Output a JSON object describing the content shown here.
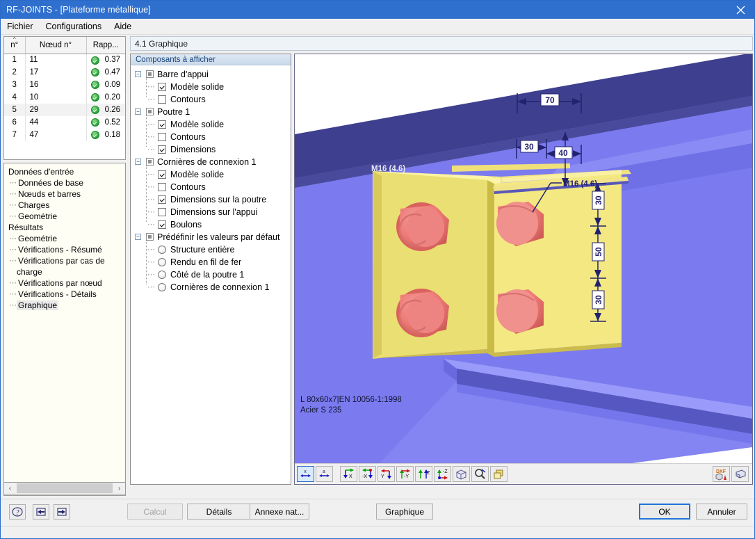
{
  "window": {
    "title": "RF-JOINTS - [Plateforme métallique]",
    "close_icon": "close-icon"
  },
  "menu": {
    "items": [
      {
        "label": "Fichier"
      },
      {
        "label": "Configurations"
      },
      {
        "label": "Aide"
      }
    ]
  },
  "node_grid": {
    "columns": [
      {
        "label": "n°",
        "sort": "^"
      },
      {
        "label": "Nœud n°"
      },
      {
        "label": "Rapp..."
      }
    ],
    "rows": [
      {
        "n": "1",
        "node": "11",
        "ratio": "0.37",
        "status": "ok",
        "selected": false
      },
      {
        "n": "2",
        "node": "17",
        "ratio": "0.47",
        "status": "ok",
        "selected": false
      },
      {
        "n": "3",
        "node": "16",
        "ratio": "0.09",
        "status": "ok",
        "selected": false
      },
      {
        "n": "4",
        "node": "10",
        "ratio": "0.20",
        "status": "ok",
        "selected": false
      },
      {
        "n": "5",
        "node": "29",
        "ratio": "0.26",
        "status": "ok",
        "selected": true
      },
      {
        "n": "6",
        "node": "44",
        "ratio": "0.52",
        "status": "ok",
        "selected": false
      },
      {
        "n": "7",
        "node": "47",
        "ratio": "0.18",
        "status": "ok",
        "selected": false
      }
    ]
  },
  "nav_tree": {
    "groups": [
      {
        "label": "Données d'entrée",
        "children": [
          {
            "label": "Données de base",
            "selected": false
          },
          {
            "label": "Nœuds et barres",
            "selected": false
          },
          {
            "label": "Charges",
            "selected": false
          },
          {
            "label": "Geométrie",
            "selected": false
          }
        ]
      },
      {
        "label": "Résultats",
        "children": [
          {
            "label": "Geométrie",
            "selected": false
          },
          {
            "label": "Vérifications - Résumé",
            "selected": false
          },
          {
            "label": "Vérifications par cas de charge",
            "selected": false
          },
          {
            "label": "Vérifications par nœud",
            "selected": false
          },
          {
            "label": "Vérifications - Détails",
            "selected": false
          },
          {
            "label": "Graphique",
            "selected": true
          }
        ]
      }
    ]
  },
  "left_scroll": {
    "left_arrow": "‹",
    "right_arrow": "›"
  },
  "center": {
    "header_title": "4.1 Graphique",
    "tree_caption": "Composants à afficher",
    "tree": [
      {
        "type": "group",
        "label": "Barre d'appui",
        "expander": "−",
        "children": [
          {
            "type": "check",
            "label": "Modèle solide",
            "checked": true
          },
          {
            "type": "check",
            "label": "Contours",
            "checked": false
          }
        ]
      },
      {
        "type": "group",
        "label": "Poutre 1",
        "expander": "−",
        "children": [
          {
            "type": "check",
            "label": "Modèle solide",
            "checked": true
          },
          {
            "type": "check",
            "label": "Contours",
            "checked": false
          },
          {
            "type": "check",
            "label": "Dimensions",
            "checked": true
          }
        ]
      },
      {
        "type": "group",
        "label": "Cornières de connexion  1",
        "expander": "−",
        "children": [
          {
            "type": "check",
            "label": "Modèle solide",
            "checked": true
          },
          {
            "type": "check",
            "label": "Contours",
            "checked": false
          },
          {
            "type": "check",
            "label": "Dimensions sur la poutre",
            "checked": true
          },
          {
            "type": "check",
            "label": "Dimensions sur l'appui",
            "checked": false
          },
          {
            "type": "check",
            "label": "Boulons",
            "checked": true
          }
        ]
      },
      {
        "type": "group",
        "label": "Prédéfinir les valeurs par défaut",
        "expander": "−",
        "children": [
          {
            "type": "radio",
            "label": "Structure entière",
            "checked": false
          },
          {
            "type": "radio",
            "label": "Rendu en fil de fer",
            "checked": false
          },
          {
            "type": "radio",
            "label": "Côté de la poutre  1",
            "checked": false
          },
          {
            "type": "radio",
            "label": "Cornières de connexion  1",
            "checked": false
          }
        ]
      }
    ]
  },
  "graphic": {
    "caption_lines": [
      "L 80x60x7|EN 10056-1:1998",
      "Acier S 235"
    ],
    "bolt_label_left": "M16 (4.6)",
    "bolt_label_right": "M16 (4.6)",
    "dimensions": {
      "top_horizontal": "70",
      "left_horizontal": "30",
      "right_horizontal": "40",
      "vertical_top": "30",
      "vertical_middle": "50",
      "vertical_bottom": "30"
    },
    "toolbar": [
      {
        "name": "view-x-button",
        "label": "x",
        "active": true
      },
      {
        "name": "view-a-button",
        "label": "a",
        "active": false
      },
      {
        "name": "view-plus-x-button",
        "label": "X",
        "active": false
      },
      {
        "name": "view-minus-x-button",
        "label": "-X",
        "active": false
      },
      {
        "name": "view-plus-y-button",
        "label": "Y",
        "active": false
      },
      {
        "name": "view-minus-y-button",
        "label": "-Y",
        "active": false
      },
      {
        "name": "view-plus-z-button",
        "label": "Z",
        "active": false
      },
      {
        "name": "view-minus-z-button",
        "label": "-Z",
        "active": false
      },
      {
        "name": "view-isometric-button",
        "label": "",
        "active": false
      },
      {
        "name": "zoom-reset-button",
        "label": "",
        "active": false
      },
      {
        "name": "render-mode-button",
        "label": "",
        "active": false
      }
    ],
    "export_buttons": [
      {
        "name": "dxf-export-button",
        "label": "DXF"
      },
      {
        "name": "print-button",
        "label": ""
      }
    ]
  },
  "footer": {
    "icon_buttons": [
      {
        "name": "help-button",
        "glyph": "?"
      },
      {
        "name": "import-button",
        "glyph": "⇤"
      },
      {
        "name": "export-button",
        "glyph": "⇥"
      }
    ],
    "buttons": [
      {
        "name": "calcul-button",
        "label": "Calcul",
        "disabled": true
      },
      {
        "name": "details-button",
        "label": "Détails",
        "disabled": false
      },
      {
        "name": "annexe-nat-button",
        "label": "Annexe nat...",
        "disabled": false
      },
      {
        "name": "graphique-button",
        "label": "Graphique",
        "disabled": false
      },
      {
        "name": "ok-button",
        "label": "OK",
        "disabled": false,
        "primary": true
      },
      {
        "name": "annuler-button",
        "label": "Annuler",
        "disabled": false
      }
    ]
  },
  "colors": {
    "titlebar": "#2f6fce",
    "beam_light": "#7b7bef",
    "beam_dark": "#3f3f8f",
    "angle_yellow": "#f2e46a",
    "bolt_red": "#ee7a76",
    "ok_green": "#29a33a",
    "accent_blue": "#1f74d8"
  }
}
